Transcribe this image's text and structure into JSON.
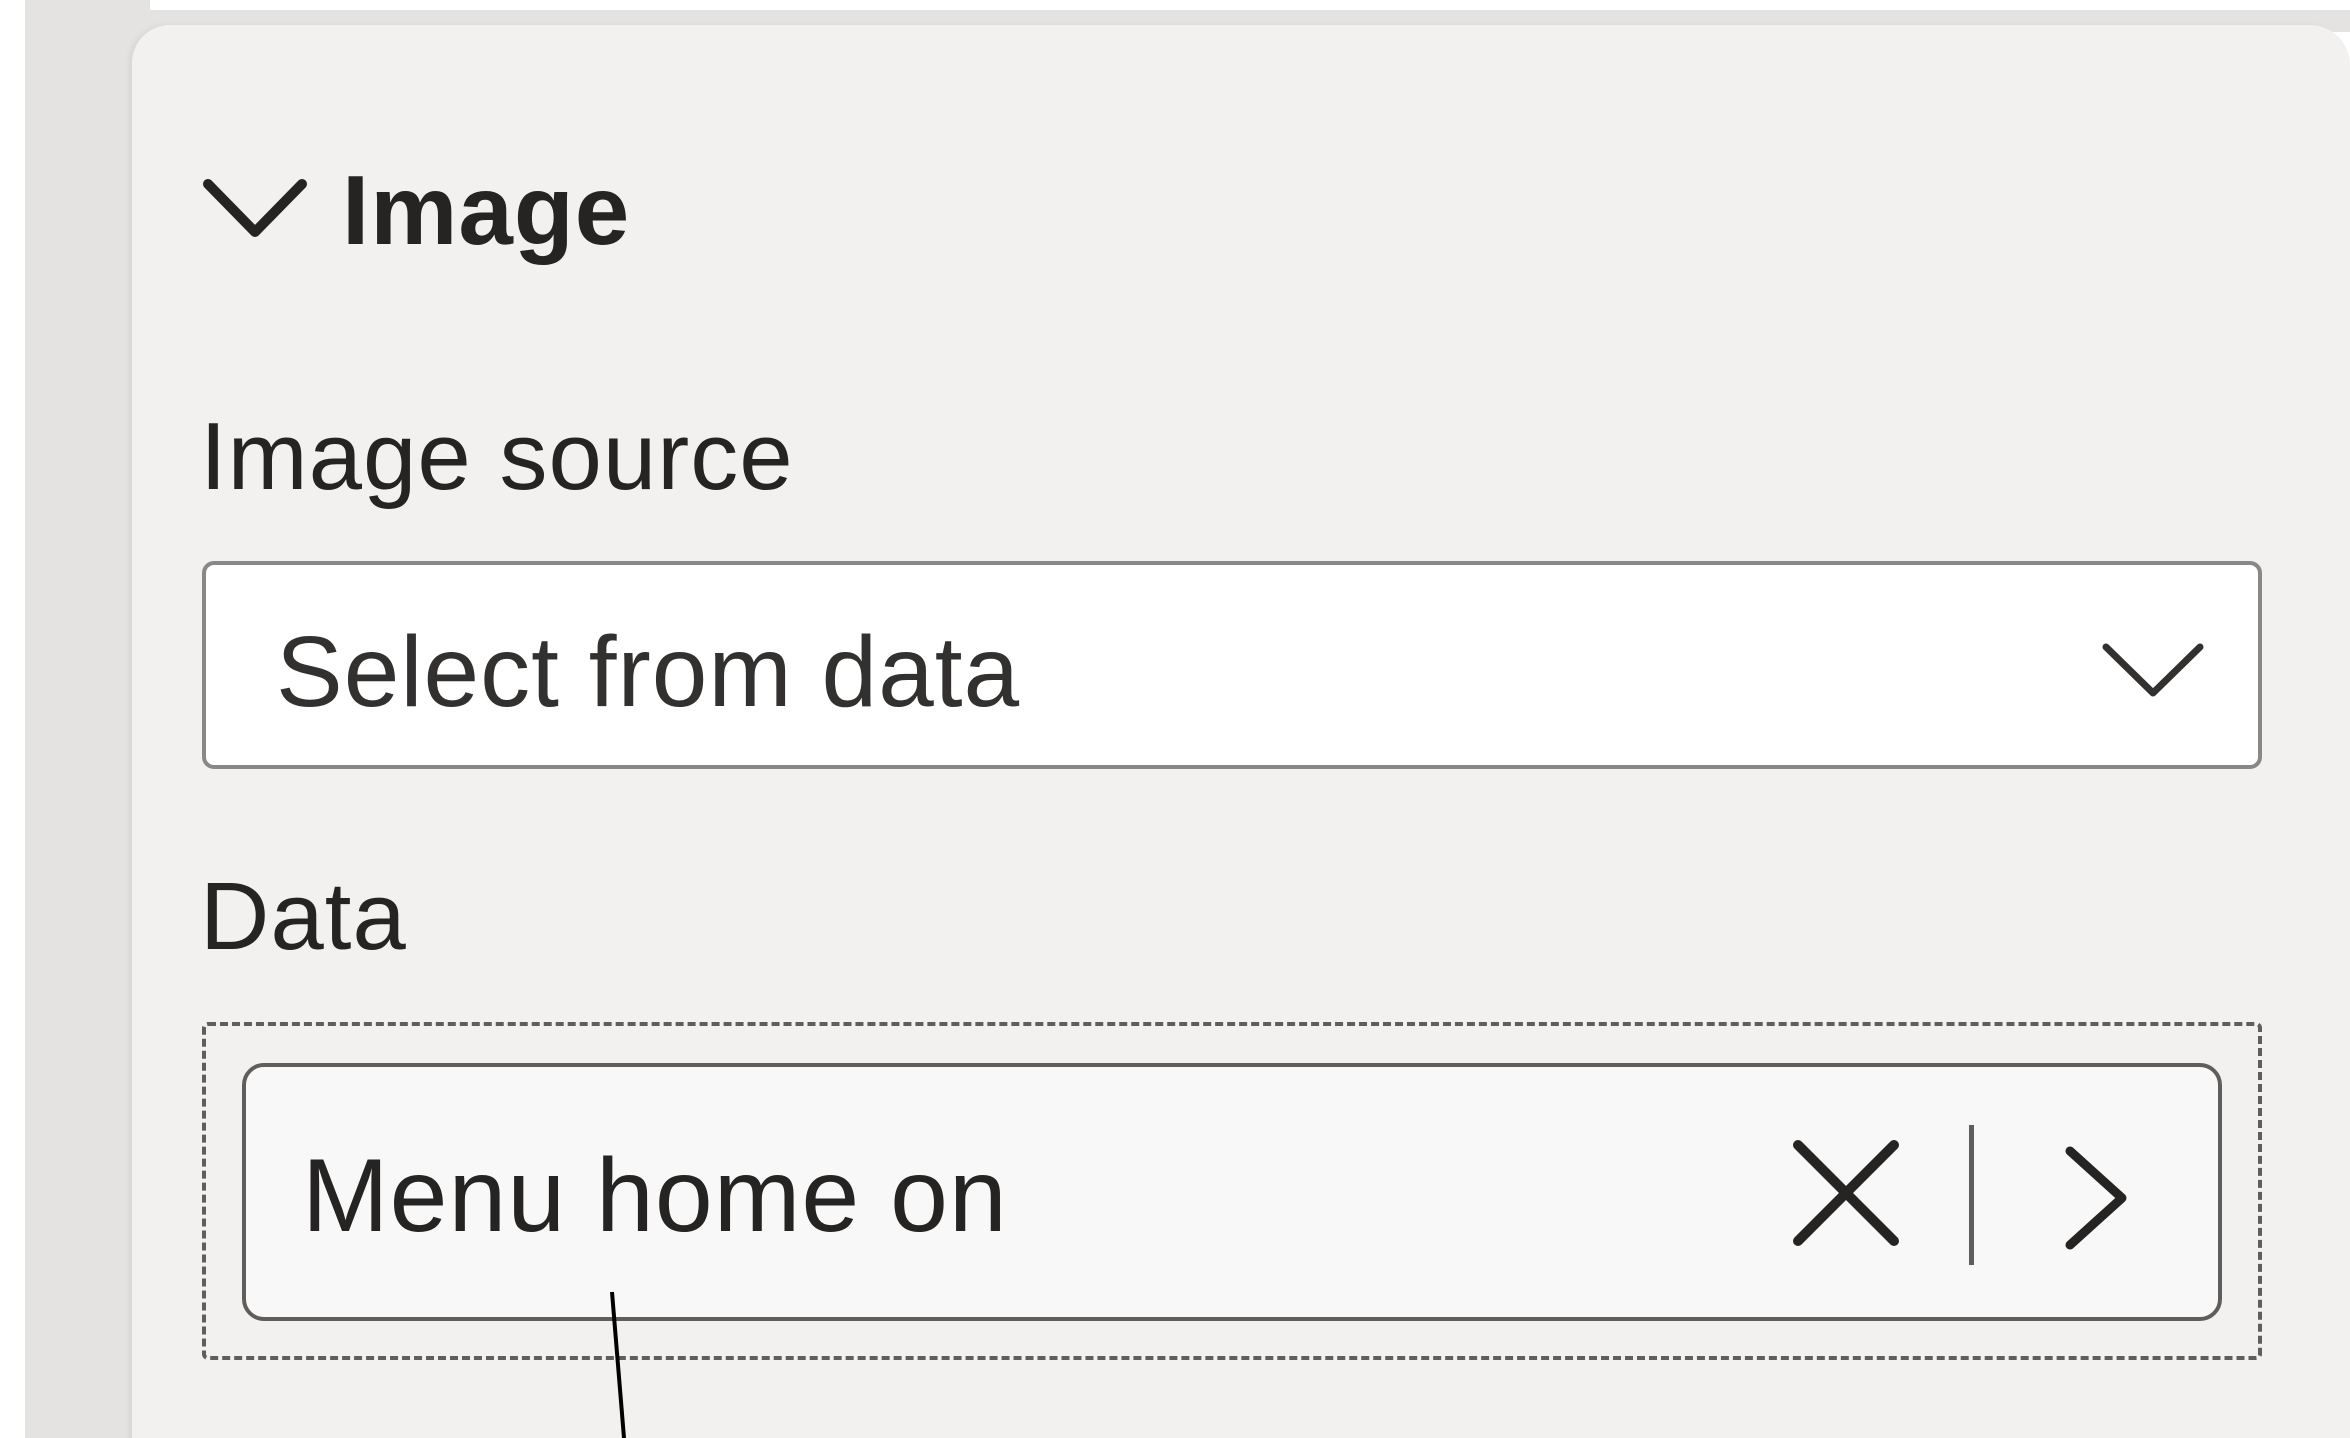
{
  "section": {
    "title": "Image",
    "expanded_icon": "chevron-down-icon"
  },
  "image_source": {
    "label": "Image source",
    "selected": "Select from data",
    "dropdown_icon": "chevron-down-icon"
  },
  "data_field": {
    "label": "Data",
    "pill_label": "Menu home on",
    "remove_icon": "close-icon",
    "expand_icon": "chevron-right-icon"
  },
  "colors": {
    "panel_bg": "#f2f1ef",
    "rail_bg": "#e4e3e2",
    "text": "#252423",
    "border": "#8a8886"
  }
}
